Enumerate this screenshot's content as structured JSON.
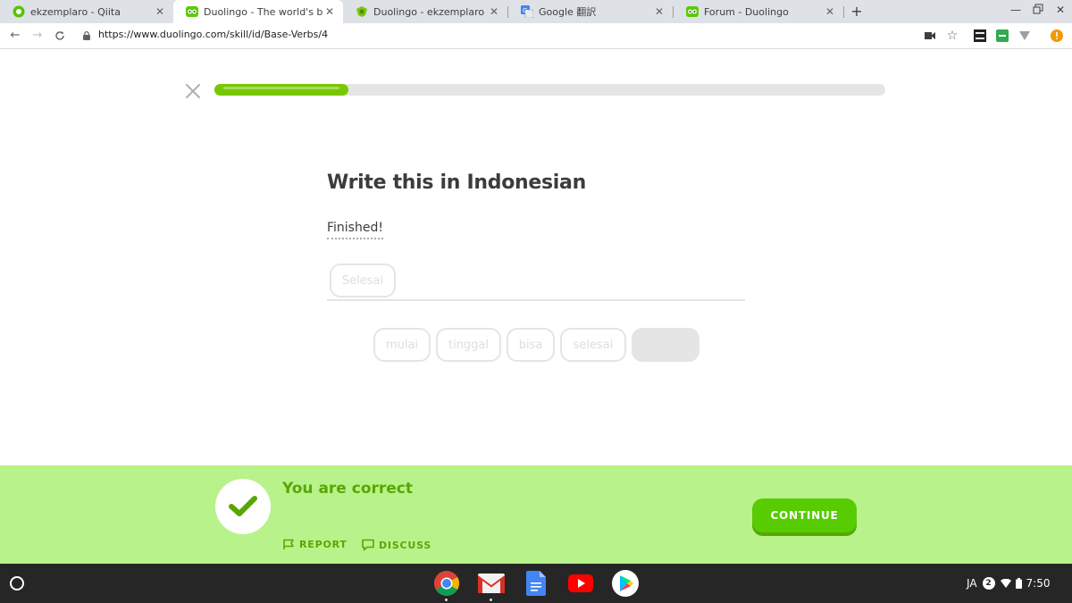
{
  "browser": {
    "tabs": [
      {
        "title": "ekzemplaro - Qiita",
        "icon": "qiita-icon"
      },
      {
        "title": "Duolingo - The world's best way to learn",
        "icon": "duolingo-owl-icon"
      },
      {
        "title": "Duolingo - ekzemplaro @ duome",
        "icon": "duome-icon"
      },
      {
        "title": "Google 翻訳",
        "icon": "google-translate-icon"
      },
      {
        "title": "Forum - Duolingo",
        "icon": "duolingo-owl-icon"
      }
    ],
    "url": "https://www.duolingo.com/skill/id/Base-Verbs/4"
  },
  "lesson": {
    "progress_fraction": 0.2,
    "prompt_title": "Write this in Indonesian",
    "source_text": "Finished!",
    "answer_chips": [
      "Selesai"
    ],
    "word_bank": [
      "mulai",
      "tinggal",
      "bisa",
      "selesai"
    ]
  },
  "result": {
    "message": "You are correct",
    "report_label": "REPORT",
    "discuss_label": "DISCUSS",
    "continue_label": "CONTINUE"
  },
  "shelf": {
    "apps": [
      "chrome-icon",
      "gmail-icon",
      "google-docs-icon",
      "youtube-icon",
      "play-store-icon"
    ],
    "ime": "JA",
    "notification_count": "2",
    "time": "7:50"
  },
  "colors": {
    "accent_green": "#58cc02",
    "footer_green": "#b8f28b",
    "text_green": "#58a700",
    "progress_green": "#78c800"
  }
}
